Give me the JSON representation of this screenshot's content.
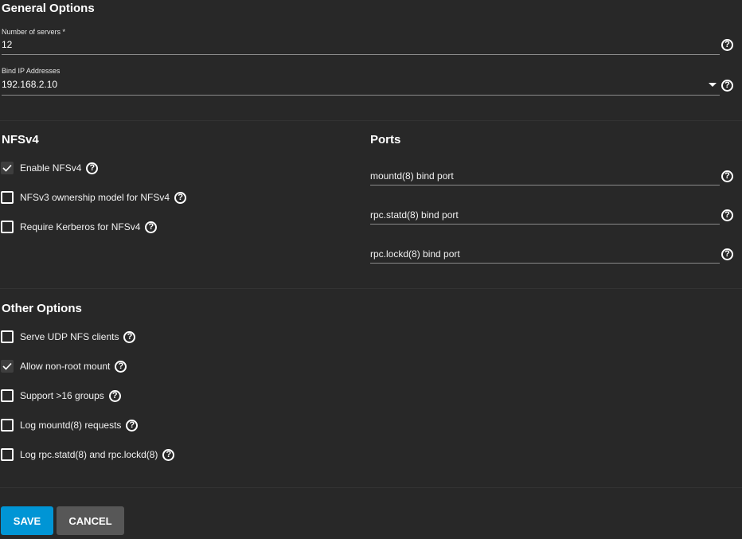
{
  "general": {
    "heading": "General Options",
    "servers_label": "Number of servers *",
    "servers_value": "12",
    "bind_label": "Bind IP Addresses",
    "bind_value": "192.168.2.10"
  },
  "nfsv4": {
    "heading": "NFSv4",
    "options": [
      {
        "label": "Enable NFSv4",
        "checked": true
      },
      {
        "label": "NFSv3 ownership model for NFSv4",
        "checked": false
      },
      {
        "label": "Require Kerberos for NFSv4",
        "checked": false
      }
    ]
  },
  "ports": {
    "heading": "Ports",
    "fields": [
      {
        "placeholder": "mountd(8) bind port"
      },
      {
        "placeholder": "rpc.statd(8) bind port"
      },
      {
        "placeholder": "rpc.lockd(8) bind port"
      }
    ]
  },
  "other": {
    "heading": "Other Options",
    "options": [
      {
        "label": "Serve UDP NFS clients",
        "checked": false
      },
      {
        "label": "Allow non-root mount",
        "checked": true
      },
      {
        "label": "Support >16 groups",
        "checked": false
      },
      {
        "label": "Log mountd(8) requests",
        "checked": false
      },
      {
        "label": "Log rpc.statd(8) and rpc.lockd(8)",
        "checked": false
      }
    ]
  },
  "buttons": {
    "save": "SAVE",
    "cancel": "CANCEL"
  },
  "icons": {
    "help": "?"
  },
  "colors": {
    "background": "#282828",
    "primary": "#0095d5",
    "cancel": "#575757"
  }
}
